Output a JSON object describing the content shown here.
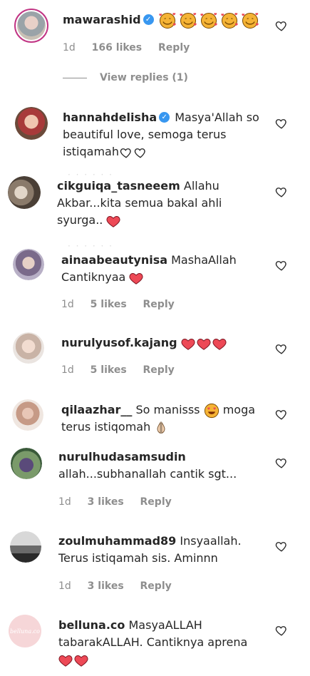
{
  "comments": [
    {
      "username": "mawarashid",
      "text": "",
      "time": "1d",
      "likes": "166 likes",
      "reply": "Reply",
      "verified": true
    },
    {
      "username": "hannahdelisha",
      "text": "Masya'Allah so beautiful love, semoga terus istiqamah",
      "verified": true
    },
    {
      "username": "cikguiqa_tasneeem",
      "text": "Allahu Akbar...kita semua bakal ahli syurga.."
    },
    {
      "username": "ainaabeautynisa",
      "text": "MashaAllah Cantiknyaa",
      "time": "1d",
      "likes": "5 likes",
      "reply": "Reply"
    },
    {
      "username": "nurulyusof.kajang",
      "text": "",
      "time": "1d",
      "likes": "5 likes",
      "reply": "Reply"
    },
    {
      "username": "qilaazhar__",
      "text": "So manisss",
      "text2": "moga terus istiqomah"
    },
    {
      "username": "nurulhudasamsudin",
      "text": "allah...subhanallah cantik sgt...",
      "time": "1d",
      "likes": "3 likes",
      "reply": "Reply"
    },
    {
      "username": "zoulmuhammad89",
      "text": "Insyaallah. Terus istiqamah sis. Aminnn",
      "time": "1d",
      "likes": "3 likes",
      "reply": "Reply"
    },
    {
      "username": "belluna.co",
      "text": "MasyaALLAH tabarakALLAH. Cantiknya aprena",
      "avatar_text": "belluna.co"
    }
  ],
  "view_replies": "View replies (1)",
  "colors": {
    "verified": "#3897f0",
    "heart": "#ed4956",
    "meta": "#8e8e8e"
  }
}
